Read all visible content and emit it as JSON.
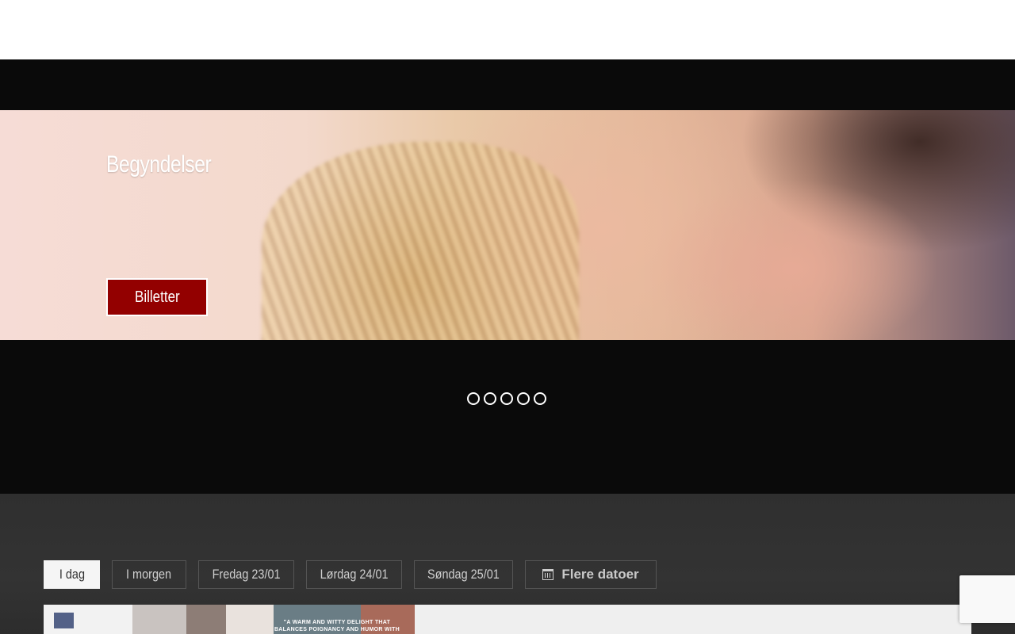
{
  "hero": {
    "title": "Begyndelser",
    "button_label": "Billetter"
  },
  "slider": {
    "slide_count": 5
  },
  "schedule": {
    "tabs": [
      {
        "label": "I dag",
        "active": true
      },
      {
        "label": "I morgen",
        "active": false
      },
      {
        "label": "Fredag 23/01",
        "active": false
      },
      {
        "label": "Lørdag 24/01",
        "active": false
      },
      {
        "label": "Søndag 25/01",
        "active": false
      }
    ],
    "more_dates_label": "Flere datoer",
    "more_dates_icon": "calendar-icon"
  },
  "poster": {
    "quote": "\"A WARM AND WITTY DELIGHT THAT BALANCES POIGNANCY AND HUMOR WITH RARE DELICACY\""
  },
  "colors": {
    "accent": "#930000",
    "band": "#0a0a0a",
    "schedule_bg": "#313131"
  }
}
